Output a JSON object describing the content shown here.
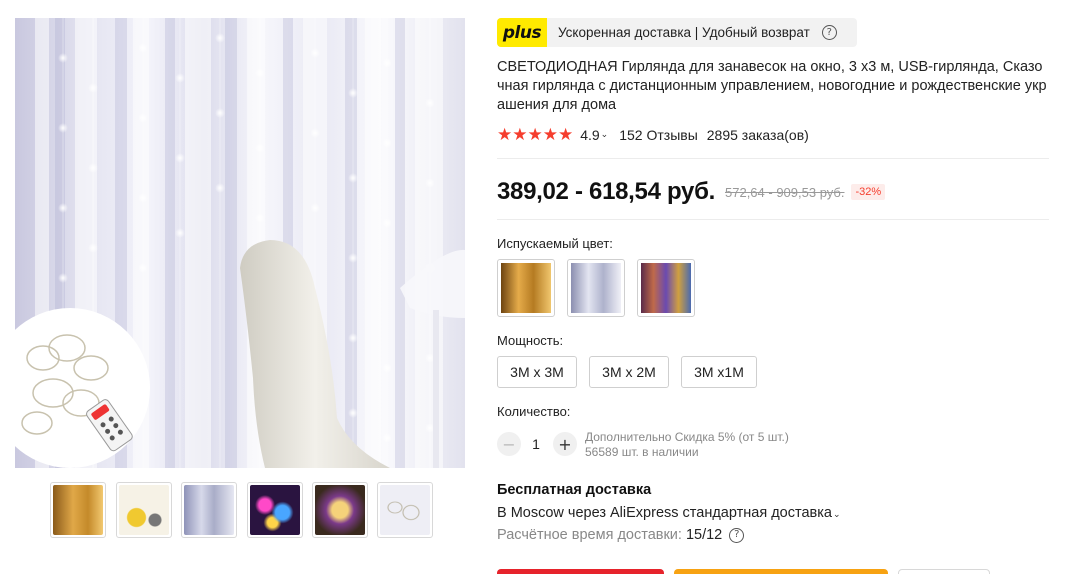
{
  "plus_bar": {
    "logo": "plus",
    "text": "Ускоренная доставка | Удобный возврат",
    "help_glyph": "?"
  },
  "product": {
    "title": "СВЕТОДИОДНАЯ Гирлянда для занавесок на окно, 3 x3 м, USB-гирлянда, Сказочная гирлянда с дистанционным управлением, новогодние и рождественские украшения для дома",
    "rating_stars": "★★★★★",
    "rating": "4.9",
    "reviews": "152 Отзывы",
    "orders": "2895 заказа(ов)"
  },
  "price": {
    "current": "389,02 - 618,54 руб.",
    "old": "572,64 - 909,53 руб.",
    "discount": "-32%"
  },
  "color": {
    "label": "Испускаемый цвет:",
    "options": [
      {
        "name": "warm-white",
        "color": "#c8952c"
      },
      {
        "name": "cool-white",
        "color": "#b9bed3"
      },
      {
        "name": "multicolor",
        "color": "#7a5a7c"
      }
    ]
  },
  "power": {
    "label": "Мощность:",
    "options": [
      "3M x 3M",
      "3M x 2M",
      "3M x1M"
    ]
  },
  "quantity": {
    "label": "Количество:",
    "minus": "−",
    "plus": "+",
    "value": "1",
    "note_line1": "Дополнительно Скидка 5% (от 5 шт.)",
    "note_line2": "56589 шт. в наличии"
  },
  "shipping": {
    "title": "Бесплатная доставка",
    "line": "В Moscow через AliExpress стандартная доставка",
    "eta_label": "Расчётное время доставки:",
    "eta_value": "15/12"
  },
  "thumbnails": [
    {
      "name": "warm-curtain",
      "color": "#c48a2a"
    },
    {
      "name": "kit-contents",
      "color": "#e8e0c8"
    },
    {
      "name": "cool-curtain",
      "color": "#a9adc8"
    },
    {
      "name": "rgb-strands",
      "color": "#6a3c8a"
    },
    {
      "name": "wreath-lights",
      "color": "#5a3d2a"
    },
    {
      "name": "coil-set",
      "color": "#dcdce8"
    }
  ],
  "colors": {
    "accent_red": "#f53d2d",
    "plus_yellow": "#ffea00",
    "buy_red": "#e6232b",
    "cart_orange": "#f7a212"
  },
  "icons": {
    "help": "help-circle-icon",
    "chevron": "chevron-down-icon",
    "star": "star-icon"
  }
}
